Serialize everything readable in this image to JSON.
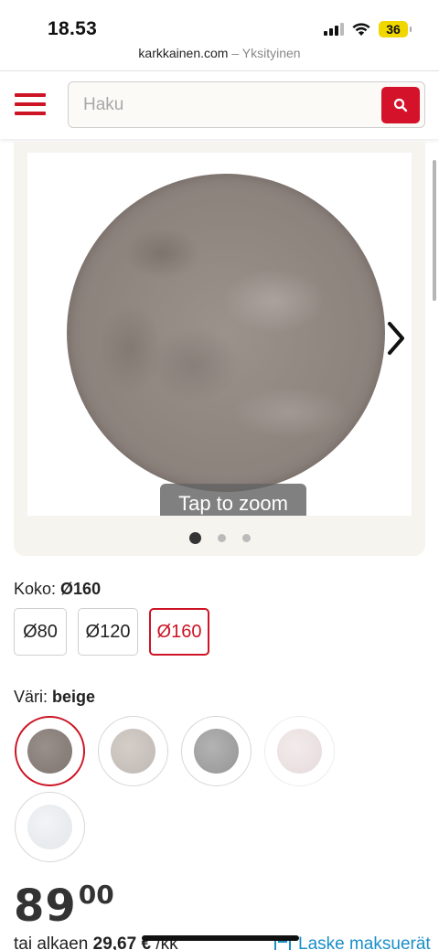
{
  "status_bar": {
    "time": "18.53",
    "battery": "36"
  },
  "browser": {
    "domain": "karkkainen.com",
    "separator": " – ",
    "mode": "Yksityinen"
  },
  "header": {
    "search_placeholder": "Haku"
  },
  "gallery": {
    "zoom_hint": "Tap to zoom",
    "image_count": 3,
    "active_index": 0
  },
  "size": {
    "label": "Koko:",
    "selected": "Ø160",
    "options": [
      "Ø80",
      "Ø120",
      "Ø160"
    ]
  },
  "color": {
    "label": "Väri:",
    "selected": "beige",
    "swatch_colors": [
      "#8f857f",
      "#c9c2bd",
      "#a6a6a6",
      "#ece2e2",
      "#e8ecf0"
    ]
  },
  "price": {
    "main": "89",
    "cents": "00"
  },
  "installment": {
    "prefix": "tai alkaen",
    "amount": "29,67 €",
    "suffix": "/kk",
    "link": "Laske maksuerät"
  },
  "colors": {
    "accent": "#cc1424",
    "link": "#1a8fc9"
  }
}
